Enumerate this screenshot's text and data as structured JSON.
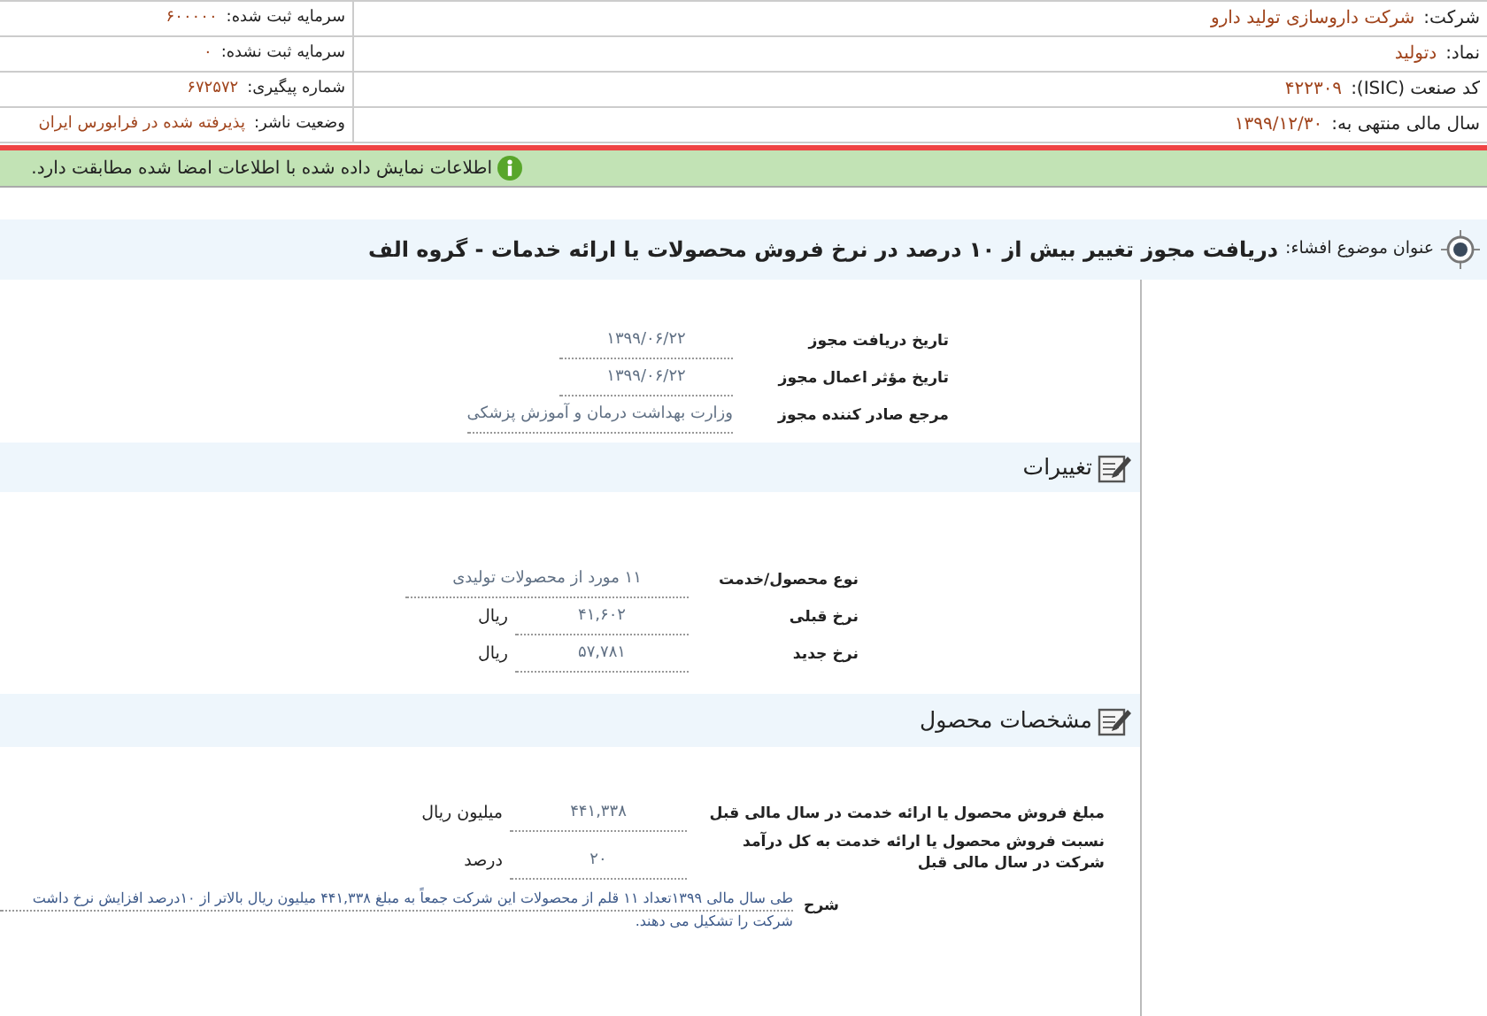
{
  "header": {
    "right_fields": [
      {
        "label": "شرکت:",
        "value": "شرکت داروسازی تولید دارو"
      },
      {
        "label": "نماد:",
        "value": "دتولید"
      },
      {
        "label": "کد صنعت (ISIC):",
        "value": "۴۲۲۳۰۹"
      },
      {
        "label": "سال مالی منتهی به:",
        "value": "۱۳۹۹/۱۲/۳۰"
      }
    ],
    "left_fields": [
      {
        "label": "سرمایه ثبت شده:",
        "value": "۶۰۰۰۰۰"
      },
      {
        "label": "سرمایه ثبت نشده:",
        "value": "۰"
      },
      {
        "label": "شماره پیگیری:",
        "value": "۶۷۲۵۷۲"
      },
      {
        "label": "وضعیت ناشر:",
        "value": "پذیرفته شده در فرابورس ایران"
      }
    ]
  },
  "notice": {
    "text": "اطلاعات نمایش داده شده با اطلاعات امضا شده مطابقت دارد."
  },
  "disclosure_title": {
    "label": "عنوان موضوع افشاء:",
    "value": "دریافت مجوز تغییر بیش از ۱۰ درصد در نرخ فروش محصولات یا ارائه خدمات - گروه الف"
  },
  "license_rows": [
    {
      "label": "تاریخ دریافت مجوز",
      "value": "۱۳۹۹/۰۶/۲۲"
    },
    {
      "label": "تاریخ مؤثر اعمال مجوز",
      "value": "۱۳۹۹/۰۶/۲۲"
    },
    {
      "label": "مرجع صادر کننده مجوز",
      "value": "وزارت بهداشت درمان و آموزش پزشکی"
    }
  ],
  "sections": [
    {
      "title": "تغییرات",
      "rows": [
        {
          "label": "نوع محصول/خدمت",
          "value": "۱۱ مورد از محصولات تولیدی"
        },
        {
          "label": "نرخ قبلی",
          "value": "۴۱,۶۰۲",
          "unit": "ریال"
        },
        {
          "label": "نرخ جدید",
          "value": "۵۷,۷۸۱",
          "unit": "ریال"
        }
      ]
    },
    {
      "title": "مشخصات محصول",
      "rows": [
        {
          "label": "مبلغ فروش محصول یا ارائه خدمت در سال مالی قبل",
          "value": "۴۴۱,۳۳۸",
          "unit": "میلیون ریال"
        },
        {
          "label": "نسبت فروش محصول یا ارائه خدمت به کل درآمد شرکت در سال مالی قبل",
          "value": "۲۰",
          "unit": "درصد"
        }
      ],
      "description": {
        "label": "شرح",
        "lines": [
          "طی سال مالی ۱۳۹۹تعداد ۱۱ قلم از محصولات این شرکت جمعاً به مبلغ ۴۴۱,۳۳۸ میلیون ریال بالاتر از ۱۰درصد افزایش نرخ داشت",
          "شرکت را تشکیل می دهند."
        ]
      }
    }
  ]
}
